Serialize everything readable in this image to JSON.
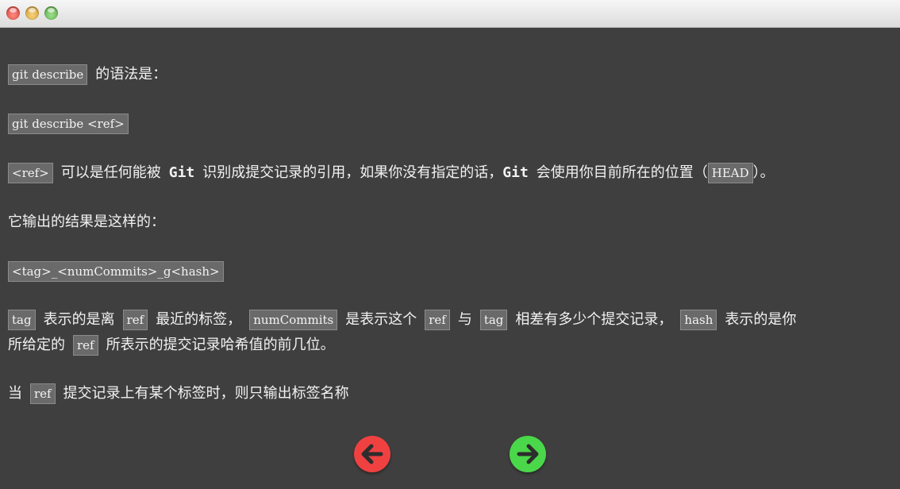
{
  "window": {
    "controls": [
      "close-icon",
      "minimize-icon",
      "maximize-icon"
    ]
  },
  "lines": {
    "l1": {
      "code": "git describe",
      "text": "的语法是："
    },
    "l2": {
      "code": "git describe <ref>"
    },
    "l3": {
      "code1": "<ref>",
      "text1": "可以是任何能被",
      "git1": "Git",
      "text2": "识别成提交记录的引用，如果你没有指定的话，",
      "git2": "Git",
      "text3": "会使用你目前所在的位置（",
      "code2": "HEAD",
      "text4": "）。"
    },
    "l4": {
      "text": "它输出的结果是这样的："
    },
    "l5": {
      "code": "<tag>_<numCommits>_g<hash>"
    },
    "l6": {
      "code1": "tag",
      "text1": "表示的是离",
      "code2": "ref",
      "text2": "最近的标签，",
      "code3": "numCommits",
      "text3": "是表示这个",
      "code4": "ref",
      "text4": "与",
      "code5": "tag",
      "text5": "相差有多少个提交记录，",
      "code6": "hash",
      "text6": "表示的是你"
    },
    "l7": {
      "text1": "所给定的",
      "code1": "ref",
      "text2": "所表示的提交记录哈希值的前几位。"
    },
    "l8": {
      "text1": "当",
      "code1": "ref",
      "text2": "提交记录上有某个标签时，则只输出标签名称"
    }
  },
  "nav": {
    "prev_icon": "arrow-left-icon",
    "next_icon": "arrow-right-icon",
    "prev_color": "#f04141",
    "next_color": "#4ad84a"
  },
  "colors": {
    "background": "#3f3f3f",
    "code_bg": "#6a6a6a",
    "text": "#f2f2f2"
  }
}
